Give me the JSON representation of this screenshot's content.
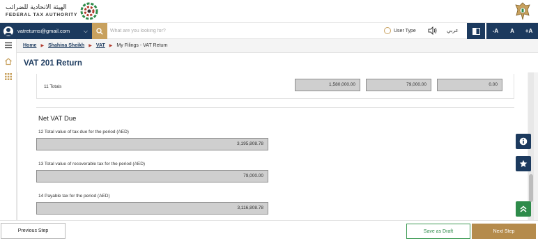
{
  "brand": {
    "name_ar": "الهيئة الاتحادية للضرائب",
    "name_en": "FEDERAL TAX AUTHORITY",
    "emblem": "uae-emblem-icon"
  },
  "toolbar": {
    "user_email": "vatreturns@gmail.com",
    "search_placeholder": "What are you looking for?",
    "user_type_label": "User Type",
    "language_toggle": "عربي",
    "font_decrease": "-A",
    "font_normal": "A",
    "font_increase": "+A"
  },
  "breadcrumb": {
    "items": [
      "Home",
      "Shahina Sheikh",
      "VAT"
    ],
    "current": "My Filings - VAT Return"
  },
  "page": {
    "title": "VAT 201 Return"
  },
  "totals": {
    "label": "11 Totals",
    "values": [
      "1,580,000.00",
      "79,000.00",
      "0.00"
    ]
  },
  "net_vat_due": {
    "title": "Net VAT Due",
    "fields": [
      {
        "label": "12 Total value of tax due for the period (AED)",
        "value": "3,195,808.78"
      },
      {
        "label": "13 Total value of recoverable tax for the period (AED)",
        "value": "79,000.00"
      },
      {
        "label": "14 Payable tax for the period (AED)",
        "value": "3,116,808.78"
      }
    ]
  },
  "footer": {
    "previous": "Previous Step",
    "save_draft": "Save as Draft",
    "next": "Next Step"
  },
  "colors": {
    "navy": "#1c3a5e",
    "gold": "#b58b4c",
    "green": "#2e8b4a"
  }
}
